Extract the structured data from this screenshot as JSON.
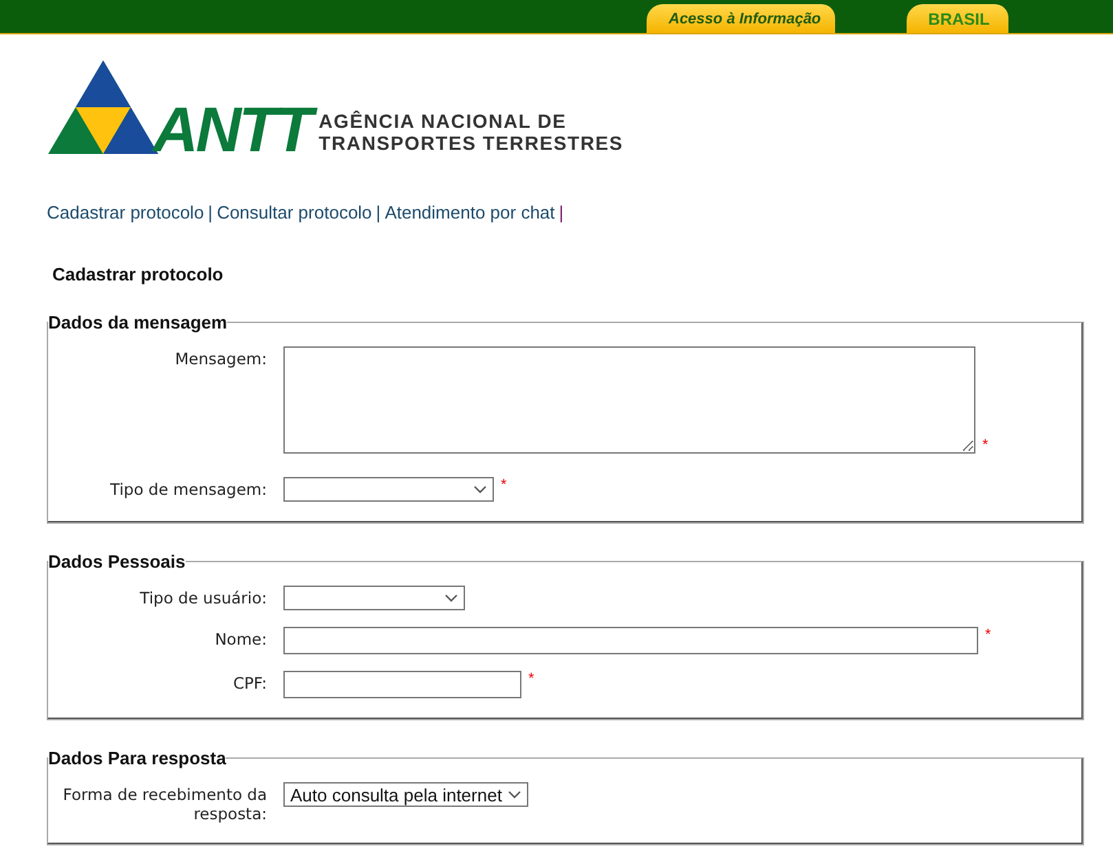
{
  "top_bar": {
    "links": [
      {
        "label": "Acesso à Informação",
        "kind": "info"
      },
      {
        "label": "BRASIL",
        "kind": "brand"
      }
    ]
  },
  "logo": {
    "acronym": "ANTT",
    "name_lines": [
      "AGÊNCIA NACIONAL DE",
      "TRANSPORTES TERRESTRES"
    ]
  },
  "nav": {
    "links": [
      "Cadastrar protocolo",
      "Consultar protocolo",
      "Atendimento por chat"
    ],
    "separator": "|"
  },
  "page_title": "Cadastrar protocolo",
  "sections": [
    {
      "legend": "Dados da mensagem",
      "fields": [
        {
          "label": "Mensagem:",
          "kind": "textarea",
          "mark": "*"
        },
        {
          "label": "Tipo de mensagem:",
          "kind": "select",
          "mark": "*"
        }
      ]
    },
    {
      "legend": "Dados Pessoais",
      "fields": [
        {
          "label": "Tipo de usuário:",
          "kind": "select"
        },
        {
          "label": "Nome:",
          "kind": "text",
          "mark": "*"
        },
        {
          "label": "CPF:",
          "kind": "text",
          "mark": "*"
        }
      ]
    },
    {
      "legend": "Dados Para resposta",
      "fields": [
        {
          "label": "Forma de recebimento da resposta:",
          "kind": "select",
          "value": "Auto consulta pela internet"
        }
      ]
    }
  ]
}
